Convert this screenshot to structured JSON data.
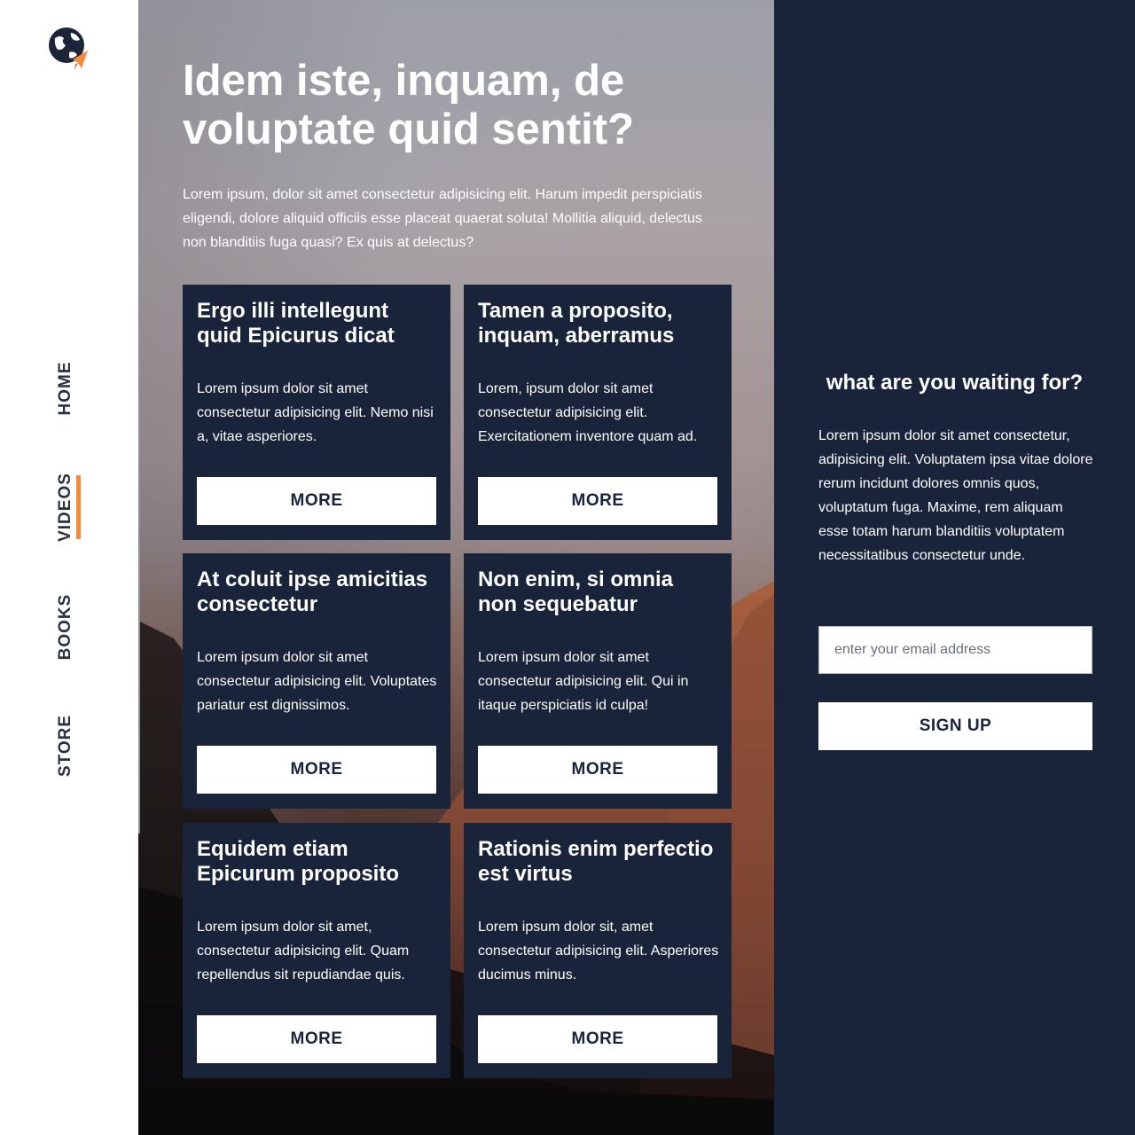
{
  "brand": {
    "logo_icon": "globe-plane-icon",
    "accent_color": "#f58a3a",
    "dark_color": "#19233a"
  },
  "nav": {
    "items": [
      {
        "label": "HOME",
        "active": false
      },
      {
        "label": "VIDEOS",
        "active": true
      },
      {
        "label": "BOOKS",
        "active": false
      },
      {
        "label": "STORE",
        "active": false
      }
    ]
  },
  "hero": {
    "title": "Idem iste, inquam, de voluptate quid sentit?",
    "text": "Lorem ipsum, dolor sit amet consectetur adipisicing elit. Harum impedit perspiciatis eligendi, dolore aliquid officiis esse placeat quaerat soluta! Mollitia aliquid, delectus non blanditiis fuga quasi? Ex quis at delectus?"
  },
  "cards": [
    {
      "title": "Ergo illi intellegunt quid Epicurus dicat",
      "text": "Lorem ipsum dolor sit amet consectetur adipisicing elit. Nemo nisi a, vitae asperiores.",
      "button": "MORE"
    },
    {
      "title": "Tamen a proposito, inquam, aberramus",
      "text": "Lorem, ipsum dolor sit amet consectetur adipisicing elit. Exercitationem inventore quam ad.",
      "button": "MORE"
    },
    {
      "title": "At coluit ipse amicitias consectetur",
      "text": "Lorem ipsum dolor sit amet consectetur adipisicing elit. Voluptates pariatur est dignissimos.",
      "button": "MORE"
    },
    {
      "title": "Non enim, si omnia non sequebatur",
      "text": "Lorem ipsum dolor sit amet consectetur adipisicing elit. Qui in itaque perspiciatis id culpa!",
      "button": "MORE"
    },
    {
      "title": "Equidem etiam Epicurum proposito",
      "text": "Lorem ipsum dolor sit amet, consectetur adipisicing elit. Quam repellendus sit repudiandae quis.",
      "button": "MORE"
    },
    {
      "title": "Rationis enim perfectio est virtus",
      "text": "Lorem ipsum dolor sit, amet consectetur adipisicing elit. Asperiores ducimus minus.",
      "button": "MORE"
    }
  ],
  "signup": {
    "title": "what are you waiting for?",
    "text": "Lorem ipsum dolor sit amet consectetur, adipisicing elit. Voluptatem ipsa vitae dolore rerum incidunt dolores omnis quos, voluptatum fuga. Maxime, rem aliquam esse totam harum blanditiis voluptatem necessitatibus consectetur unde.",
    "email_placeholder": "enter your email address",
    "email_value": "",
    "button": "SIGN UP"
  }
}
